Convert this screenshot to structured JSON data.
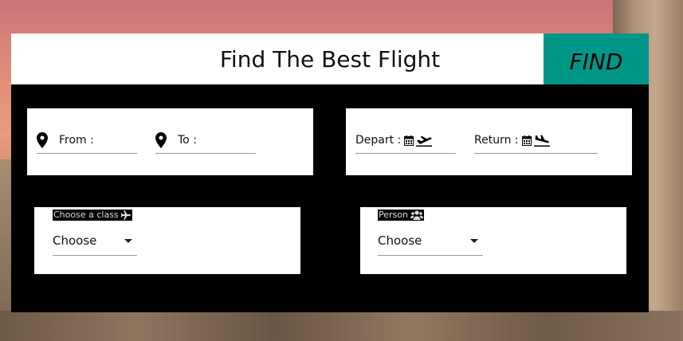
{
  "header": {
    "title": "Find The Best Flight",
    "find_label": "FIND"
  },
  "location": {
    "from_label": "From :",
    "to_label": "To :"
  },
  "dates": {
    "depart_label": "Depart :",
    "return_label": "Return :"
  },
  "travel_class": {
    "label": "Choose a class",
    "selected": "Choose"
  },
  "person": {
    "label": "Person",
    "selected": "Choose"
  },
  "colors": {
    "accent": "#009687",
    "card": "#000000",
    "panel": "#ffffff"
  },
  "icons": [
    "location-pin-icon",
    "calendar-icon",
    "plane-departure-icon",
    "plane-arrival-icon",
    "plane-icon",
    "users-icon",
    "chevron-down-icon"
  ]
}
